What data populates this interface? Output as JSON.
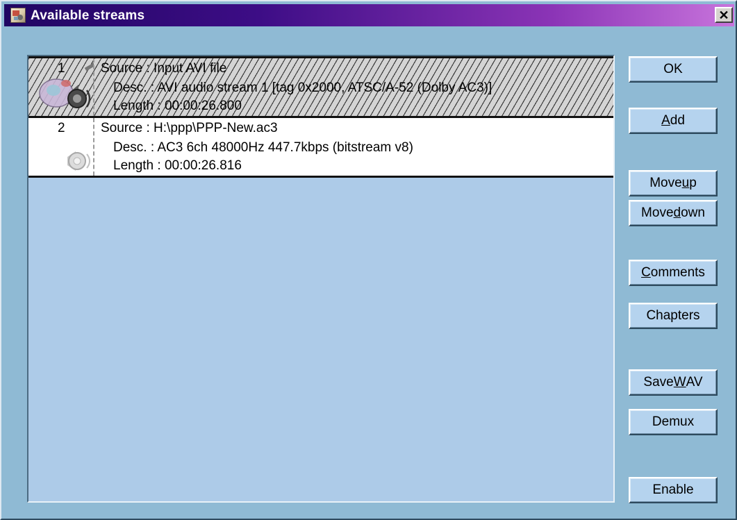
{
  "window": {
    "title": "Available streams",
    "close_label": "✕"
  },
  "streams": [
    {
      "number": "1",
      "source": "Source : Input AVI file",
      "desc": "Desc. : AVI audio stream 1 [tag 0x2000, ATSC/A-52 (Dolby AC3)]",
      "length": "Length : 00:00:26.800",
      "selected": true
    },
    {
      "number": "2",
      "source": "Source : H:\\ppp\\PPP-New.ac3",
      "desc": "Desc. : AC3 6ch 48000Hz 447.7kbps (bitstream v8)",
      "length": "Length : 00:00:26.816",
      "selected": false
    }
  ],
  "buttons": {
    "ok": "OK",
    "add": {
      "pre": "",
      "key": "A",
      "post": "dd"
    },
    "move_up": {
      "pre": "Move ",
      "key": "u",
      "post": "p"
    },
    "move_down": {
      "pre": "Move ",
      "key": "d",
      "post": "own"
    },
    "comments": {
      "pre": "",
      "key": "C",
      "post": "omments"
    },
    "chapters": "Chapters",
    "save_wav": {
      "pre": "Save ",
      "key": "W",
      "post": "AV"
    },
    "demux": "Demux",
    "enable": "Enable"
  },
  "colors": {
    "title_start": "#200662",
    "title_end": "#c874dc",
    "window_bg": "#8fbad4",
    "list_bg": "#adcbe8"
  }
}
